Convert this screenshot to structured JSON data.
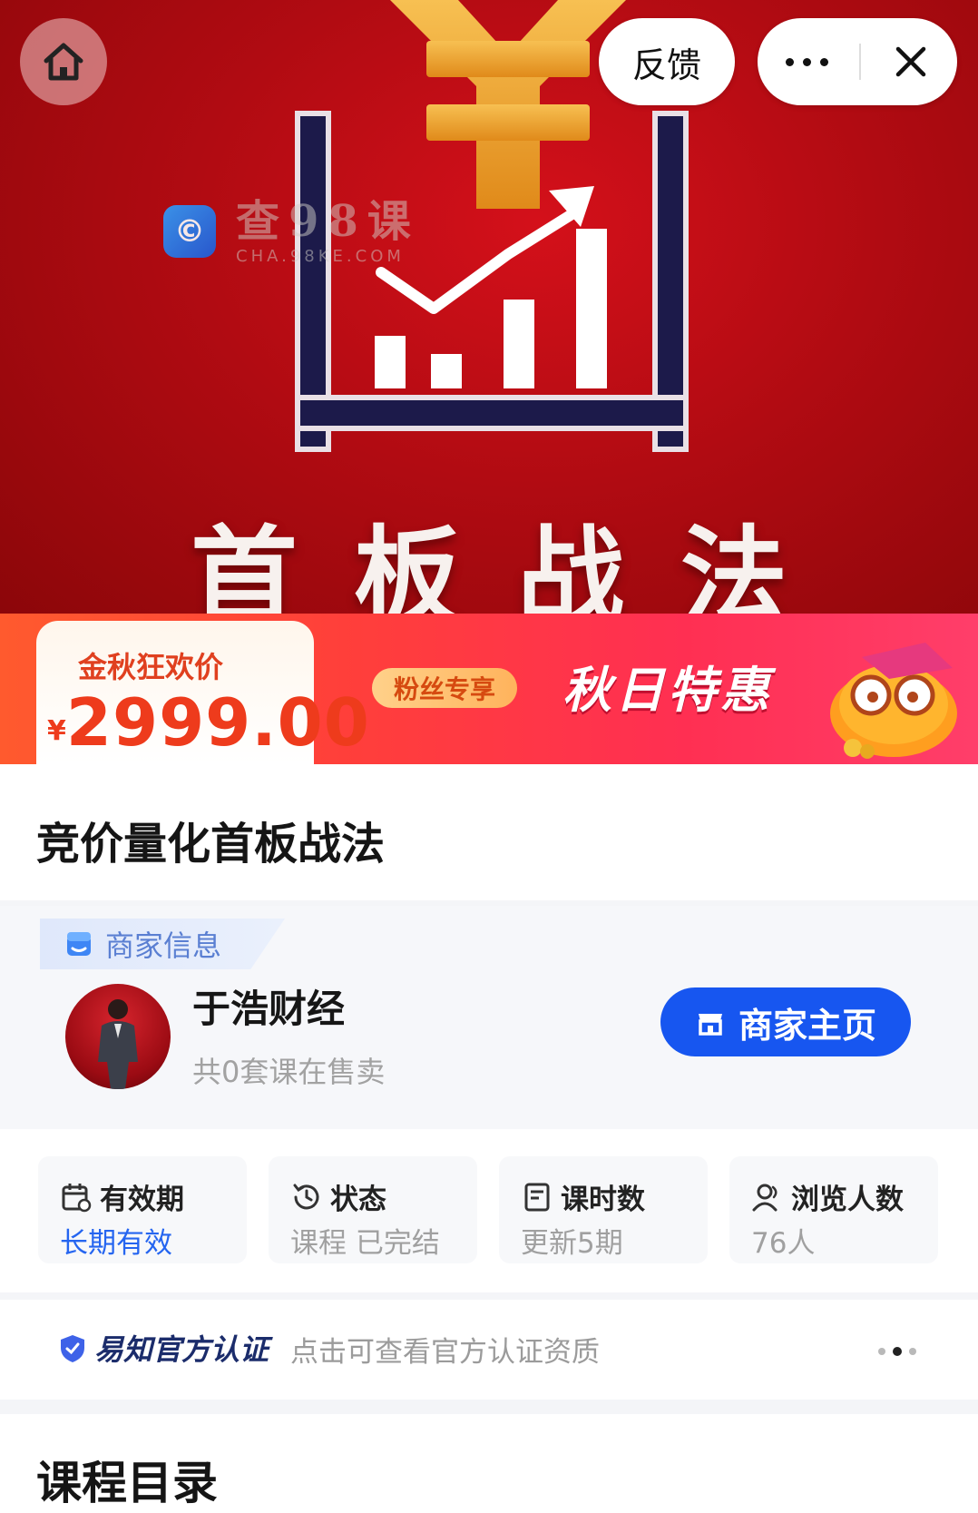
{
  "hero": {
    "title": "首板战法",
    "watermark_name": "查98课",
    "watermark_domain": "CHA.98KE.COM"
  },
  "topbar": {
    "feedback_label": "反馈",
    "icons": [
      "home-icon",
      "more-icon",
      "close-icon"
    ]
  },
  "banner": {
    "price_label": "金秋狂欢价",
    "currency": "¥",
    "price": "2999.00",
    "fans_tag": "粉丝专享",
    "promo": "秋日特惠"
  },
  "course": {
    "title": "竞价量化首板战法"
  },
  "merchant": {
    "section_label": "商家信息",
    "name": "于浩财经",
    "course_count_text": "共0套课在售卖",
    "homepage_button": "商家主页"
  },
  "stats": [
    {
      "label": "有效期",
      "value": "长期有效",
      "icon": "calendar-icon",
      "highlight": true
    },
    {
      "label": "状态",
      "value": "课程 已完结",
      "icon": "clock-icon",
      "highlight": false
    },
    {
      "label": "课时数",
      "value": "更新5期",
      "icon": "document-icon",
      "highlight": false
    },
    {
      "label": "浏览人数",
      "value": "76人",
      "icon": "user-icon",
      "highlight": false
    }
  ],
  "certification": {
    "brand": "易知官方认证",
    "text": "点击可查看官方认证资质"
  },
  "catalog": {
    "title": "课程目录"
  },
  "colors": {
    "accent_blue": "#1756f0",
    "price_red": "#ee3b1c",
    "hero_red": "#b10b12"
  }
}
